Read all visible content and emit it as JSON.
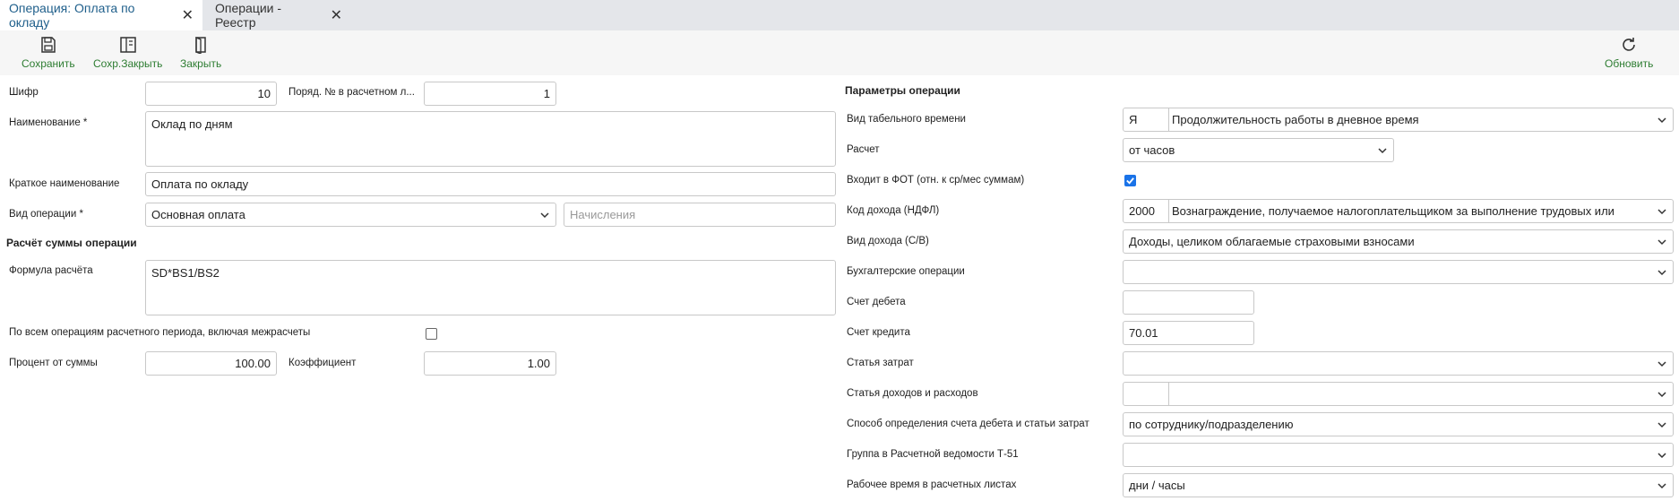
{
  "tabs": [
    {
      "label": "Операция: Оплата по окладу",
      "active": true
    },
    {
      "label": "Операции - Реестр",
      "active": false
    }
  ],
  "toolbar": {
    "save": "Сохранить",
    "save_close": "Сохр.Закрыть",
    "close": "Закрыть",
    "refresh": "Обновить"
  },
  "left": {
    "code_label": "Шифр",
    "code_value": "10",
    "order_label": "Поряд. № в расчетном л...",
    "order_value": "1",
    "name_label": "Наименование *",
    "name_value": "Оклад по дням",
    "short_name_label": "Краткое наименование",
    "short_name_value": "Оплата по окладу",
    "op_type_label": "Вид операции *",
    "op_type_value": "Основная оплата",
    "accruals_placeholder": "Начисления",
    "calc_section": "Расчёт суммы операции",
    "formula_label": "Формула расчёта",
    "formula_value": "SD*BS1/BS2",
    "all_ops_label": "По всем операциям расчетного периода, включая межрасчеты",
    "all_ops_checked": false,
    "percent_label": "Процент от суммы",
    "percent_value": "100.00",
    "coef_label": "Коэффициент",
    "coef_value": "1.00"
  },
  "right": {
    "section": "Параметры операции",
    "timesheet_label": "Вид табельного времени",
    "timesheet_code": "Я",
    "timesheet_value": "Продолжительность работы в дневное время",
    "calc_label": "Расчет",
    "calc_value": "от часов",
    "fot_label": "Входит в ФОТ (отн. к ср/мес суммам)",
    "fot_checked": true,
    "income_code_label": "Код дохода (НДФЛ)",
    "income_code": "2000",
    "income_code_value": "Вознаграждение, получаемое налогоплательщиком за выполнение трудовых или",
    "income_type_label": "Вид дохода (С/В)",
    "income_type_value": "Доходы, целиком облагаемые страховыми взносами",
    "acc_ops_label": "Бухгалтерские операции",
    "acc_ops_value": "",
    "debit_label": "Счет дебета",
    "debit_value": "",
    "credit_label": "Счет кредита",
    "credit_value": "70.01",
    "cost_item_label": "Статья затрат",
    "cost_item_value": "",
    "income_exp_label": "Статья доходов и расходов",
    "income_exp_value": "",
    "method_label": "Способ определения счета дебета и статьи затрат",
    "method_value": "по сотруднику/подразделению",
    "group_label": "Группа в Расчетной ведомости Т-51",
    "group_value": "",
    "worktime_label": "Рабочее время в расчетных листах",
    "worktime_value": "дни / часы"
  },
  "colors": {
    "accent_green": "#2e7d32",
    "tab_active_text": "#1f5f8b",
    "checkbox": "#1a73e8"
  }
}
